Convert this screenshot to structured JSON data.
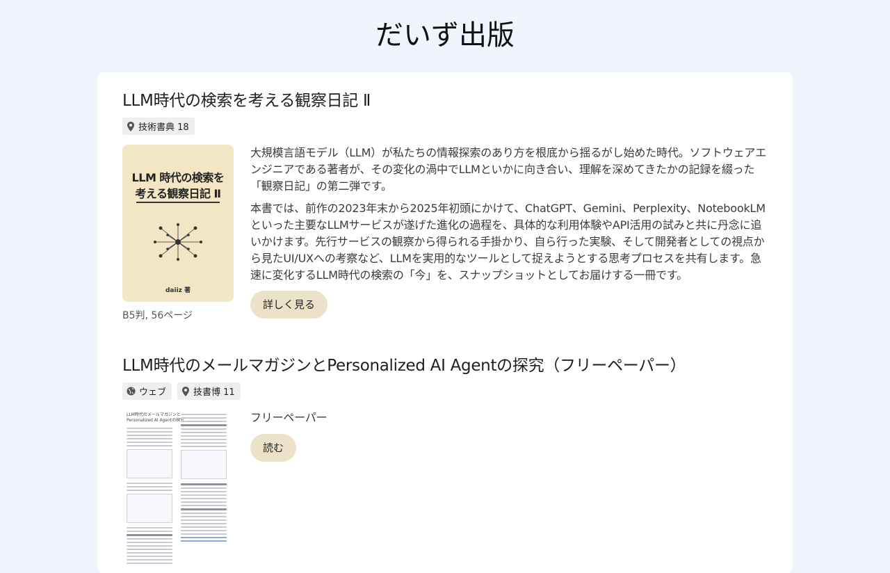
{
  "site": {
    "title": "だいず出版"
  },
  "books": [
    {
      "title": "LLM時代の検索を考える観察日記 Ⅱ",
      "tags": [
        {
          "icon": "location-pin-icon",
          "label": "技術書典 18"
        }
      ],
      "cover": {
        "title_line1": "LLM 時代の検索を",
        "title_line2": "考える観察日記 Ⅱ",
        "author": "daiiz 著",
        "background": "#f2e6c4"
      },
      "format": "B5判, 56ページ",
      "description": [
        "大規模言語モデル（LLM）が私たちの情報探索のあり方を根底から揺るがし始めた時代。ソフトウェアエンジニアである著者が、その変化の渦中でLLMといかに向き合い、理解を深めてきたかの記録を綴った「観察日記」の第二弾です。",
        "本書では、前作の2023年末から2025年初頭にかけて、ChatGPT、Gemini、Perplexity、NotebookLMといった主要なLLMサービスが遂げた進化の過程を、具体的な利用体験やAPI活用の試みと共に丹念に追いかけます。先行サービスの観察から得られる手掛かり、自ら行った実験、そして開発者としての視点から見たUI/UXへの考察など、LLMを実用的なツールとして捉えようとする思考プロセスを共有します。急速に変化するLLM時代の検索の「今」を、スナップショットとしてお届けする一冊です。"
      ],
      "button_label": "詳しく見る"
    },
    {
      "title": "LLM時代のメールマガジンとPersonalized AI Agentの探究（フリーペーパー）",
      "tags": [
        {
          "icon": "globe-icon",
          "label": "ウェブ"
        },
        {
          "icon": "location-pin-icon",
          "label": "技書博 11"
        }
      ],
      "cover": {
        "title_line1": "LLM時代のメールマガジンと",
        "title_line2": "Personalized AI Agentの探究"
      },
      "description": [
        "フリーペーパー"
      ],
      "button_label": "読む"
    }
  ],
  "colors": {
    "page_background": "#f0f5fd",
    "card_background": "#ffffff",
    "button_background": "#ece2c7",
    "tag_background": "#efefef"
  }
}
